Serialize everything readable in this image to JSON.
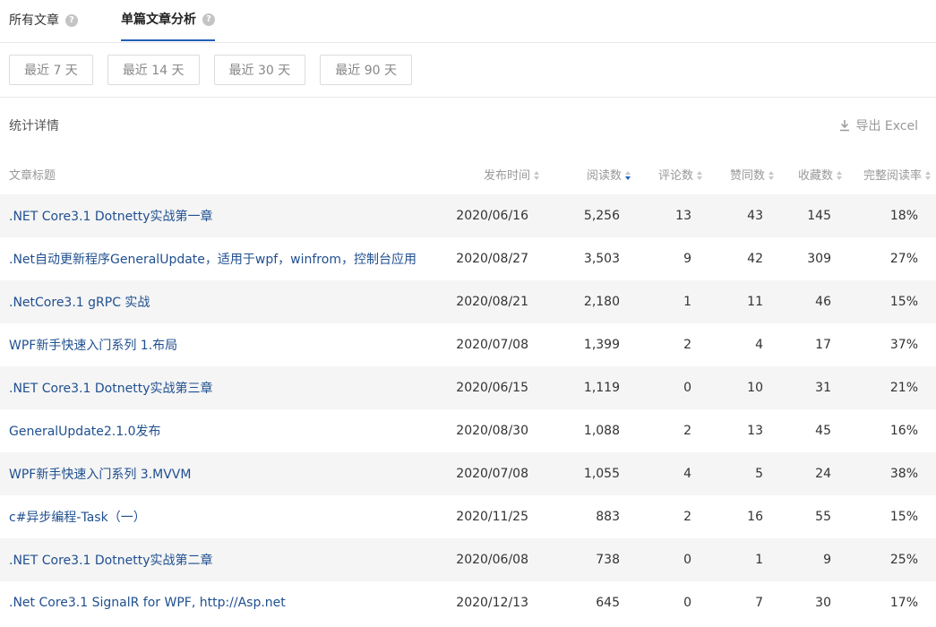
{
  "tabs": [
    {
      "label": "所有文章",
      "active": false
    },
    {
      "label": "单篇文章分析",
      "active": true
    }
  ],
  "ranges": [
    "最近 7 天",
    "最近 14 天",
    "最近 30 天",
    "最近 90 天"
  ],
  "section": {
    "title": "统计详情",
    "export_label": "导出 Excel"
  },
  "columns": [
    "文章标题",
    "发布时间",
    "阅读数",
    "评论数",
    "赞同数",
    "收藏数",
    "完整阅读率"
  ],
  "rows": [
    [
      ".NET Core3.1 Dotnetty实战第一章",
      "2020/06/16",
      "5,256",
      "13",
      "43",
      "145",
      "18%"
    ],
    [
      ".Net自动更新程序GeneralUpdate，适用于wpf，winfrom，控制台应用",
      "2020/08/27",
      "3,503",
      "9",
      "42",
      "309",
      "27%"
    ],
    [
      ".NetCore3.1 gRPC 实战",
      "2020/08/21",
      "2,180",
      "1",
      "11",
      "46",
      "15%"
    ],
    [
      "WPF新手快速入门系列 1.布局",
      "2020/07/08",
      "1,399",
      "2",
      "4",
      "17",
      "37%"
    ],
    [
      ".NET Core3.1 Dotnetty实战第三章",
      "2020/06/15",
      "1,119",
      "0",
      "10",
      "31",
      "21%"
    ],
    [
      "GeneralUpdate2.1.0发布",
      "2020/08/30",
      "1,088",
      "2",
      "13",
      "45",
      "16%"
    ],
    [
      "WPF新手快速入门系列 3.MVVM",
      "2020/07/08",
      "1,055",
      "4",
      "5",
      "24",
      "38%"
    ],
    [
      "c#异步编程-Task（一）",
      "2020/11/25",
      "883",
      "2",
      "16",
      "55",
      "15%"
    ],
    [
      ".NET Core3.1 Dotnetty实战第二章",
      "2020/06/08",
      "738",
      "0",
      "1",
      "9",
      "25%"
    ],
    [
      ".Net Core3.1 SignalR for WPF, http://Asp.net",
      "2020/12/13",
      "645",
      "0",
      "7",
      "30",
      "17%"
    ]
  ],
  "colors": {
    "accent": "#1f60b6",
    "link": "#1f4f8f",
    "stripe": "#f5f5f5"
  }
}
